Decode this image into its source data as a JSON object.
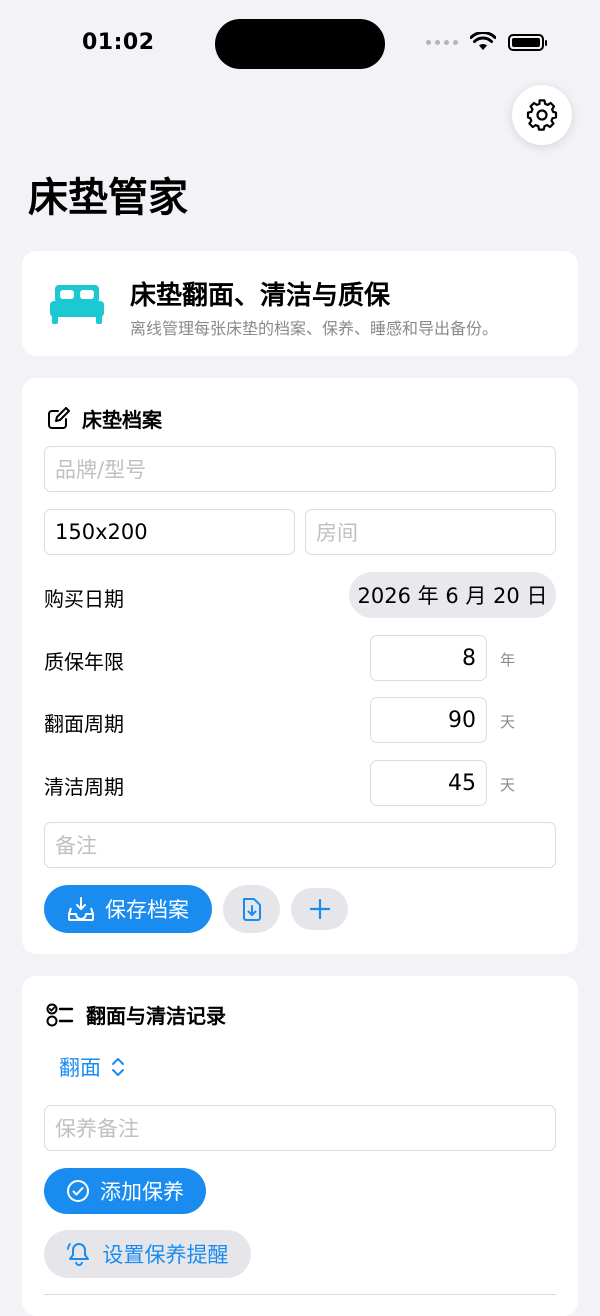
{
  "status": {
    "time": "01:02"
  },
  "header": {
    "title": "床垫管家"
  },
  "hero": {
    "title": "床垫翻面、清洁与质保",
    "subtitle": "离线管理每张床垫的档案、保养、睡感和导出备份。"
  },
  "profile": {
    "section_title": "床垫档案",
    "brand_placeholder": "品牌/型号",
    "size_value": "150x200",
    "room_placeholder": "房间",
    "purchase_label": "购买日期",
    "purchase_date": "2026 年 6 月 20 日",
    "warranty_label": "质保年限",
    "warranty_value": "8",
    "warranty_unit": "年",
    "flip_label": "翻面周期",
    "flip_value": "90",
    "flip_unit": "天",
    "clean_label": "清洁周期",
    "clean_value": "45",
    "clean_unit": "天",
    "notes_placeholder": "备注",
    "save_label": "保存档案"
  },
  "records": {
    "section_title": "翻面与清洁记录",
    "type_selected": "翻面",
    "note_placeholder": "保养备注",
    "add_label": "添加保养",
    "reminder_label": "设置保养提醒"
  },
  "colors": {
    "accent": "#1A8CF0",
    "bed_icon": "#1CC8D2",
    "background": "#F2F2F7"
  },
  "icons": [
    "gear-icon",
    "bed-icon",
    "edit-icon",
    "tray-download-icon",
    "document-download-icon",
    "plus-icon",
    "checklist-icon",
    "chevron-updown-icon",
    "checkmark-circle-icon",
    "bell-icon"
  ]
}
